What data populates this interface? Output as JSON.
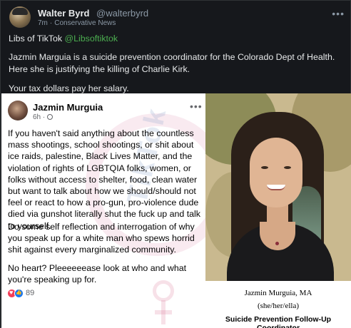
{
  "post": {
    "author_name": "Walter Byrd",
    "author_handle": "@walterbyrd",
    "time": "7m",
    "community": "Conservative News",
    "separator": "·",
    "more_label": "•••",
    "text_line1_prefix": "Libs of TikTok",
    "text_line1_mention": "@Libsoftiktok",
    "text_para2": "Jazmin Marguia is a suicide prevention coordinator for the Colorado Dept of Health. Here she is justifying the killing of Charlie Kirk.",
    "text_para3": "Your tax dollars pay her salary."
  },
  "embed": {
    "watermark_text": "TikTok",
    "fb_post": {
      "name": "Jazmin Murguia",
      "time": "6h",
      "separator": "·",
      "more_label": "•••",
      "para1": "If you haven't said anything about the countless mass shootings, school shootings, or shit about ice raids, palestine, Black Lives Matter, and the violation of rights of LGBTQIA folks, women, or folks without access to shelter, food, clean water  but want to talk about how we should/should not feel or react to how a pro-gun, pro-violence dude died via gunshot  literally shut the fuck up and talk to yourself.",
      "para2": "Do some self reflection and interrogation of why you speak up for a white man who spews horrid shit against every marginalized community.",
      "para3": "No heart? Pleeeeeease look at who and what you're speaking up for.",
      "reaction_count": "89"
    },
    "photo_caption": {
      "name": "Jazmin Murguia, MA",
      "pronouns": "(she/her/ella)",
      "role": "Suicide Prevention Follow-Up Coordinator"
    }
  },
  "colors": {
    "background": "#16181c",
    "mention": "#4caf50",
    "text": "#e7e9ea",
    "muted": "#8b98a5",
    "fb_love": "#f33e58",
    "fb_like": "#1877f2"
  },
  "icons": {
    "more": "more-horizontal-icon",
    "globe": "globe-icon",
    "love": "love-reaction-icon",
    "like": "like-reaction-icon"
  }
}
